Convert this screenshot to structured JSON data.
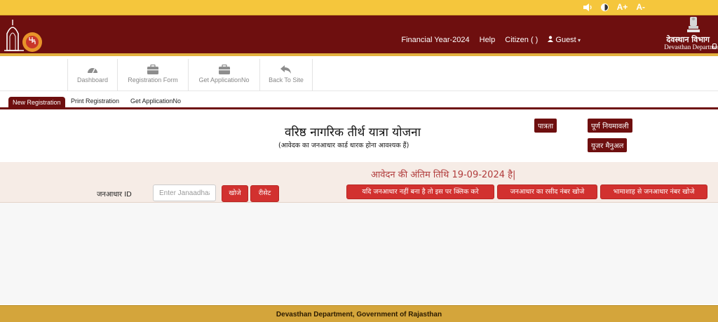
{
  "topbar": {
    "tools": [
      {
        "name": "font-decrease-icon",
        "label": "A-"
      },
      {
        "name": "font-increase-icon",
        "label": "A+"
      }
    ]
  },
  "header": {
    "nav": {
      "financial_year": "Financial Year-2024",
      "help": "Help",
      "citizen": "Citizen",
      "citizen_paren": "( )",
      "guest": "Guest"
    },
    "dept_hindi": "देवस्थान विभाग",
    "dept_english": "Devasthan Department"
  },
  "toolbar": {
    "items": [
      {
        "label": "Dashboard",
        "icon": "dashboard-icon"
      },
      {
        "label": "Registration Form",
        "icon": "briefcase-icon"
      },
      {
        "label": "Get ApplicationNo",
        "icon": "briefcase-icon"
      },
      {
        "label": "Back To Site",
        "icon": "back-arrow-icon"
      }
    ]
  },
  "tabs": [
    {
      "label": "New Registration",
      "active": true
    },
    {
      "label": "Print Registration",
      "active": false
    },
    {
      "label": "Get ApplicationNo",
      "active": false
    }
  ],
  "scheme": {
    "title": "वरिष्ठ नागरिक तीर्थ यात्रा योजना",
    "subtitle": "(आवेदक का जनआधार कार्ड धारक होना आवश्यक हैं)",
    "eligibility_btn": "पात्रता",
    "rules_btn": "पूर्ण नियमावली",
    "manual_btn": "यूजर मैनुअल"
  },
  "form": {
    "deadline": "आवेदन की अंतिम तिथि 19-09-2024 है|",
    "janaadhaar_label": "जनआधार ID",
    "janaadhaar_placeholder": "Enter Janaadhaar ID",
    "search_btn": "खोजे",
    "reset_btn": "रीसेट",
    "no_janaadhaar_btn": "यदि जनआधार नहीं बना है तो इस पर क्लिक करे",
    "receipt_search_btn": "जनआधार का रसीद नंबर खोजे",
    "bhamashah_search_btn": "भामाशाह से जनआधार नंबर खोजे"
  },
  "footer": {
    "text": "Devasthan Department, Government of Rajasthan"
  },
  "colors": {
    "header_maroon": "#6e0f0f",
    "topbar_gold": "#f5c63c",
    "button_red": "#d2312f",
    "footer_gold": "#d4a53b"
  }
}
